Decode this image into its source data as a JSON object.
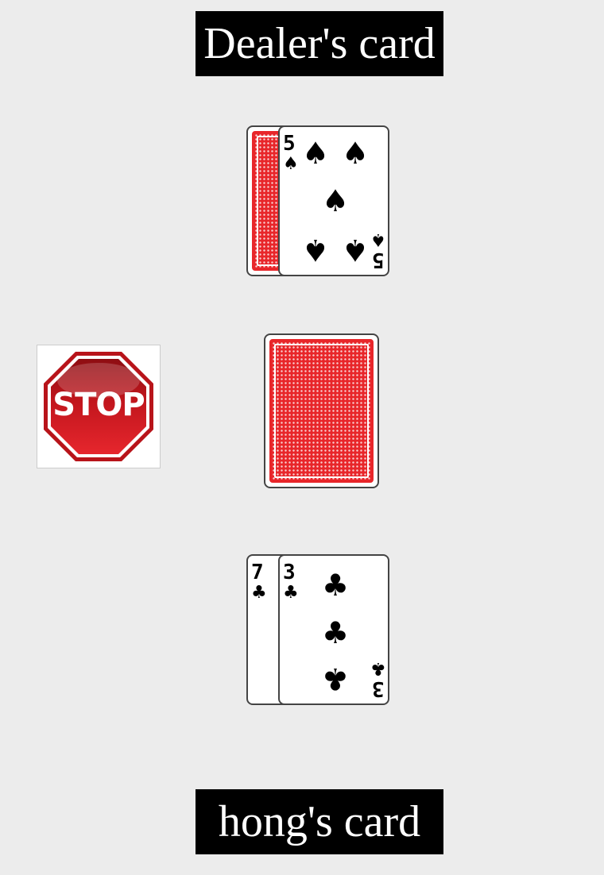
{
  "dealer": {
    "label": "Dealer's card",
    "cards": [
      {
        "face": "down"
      },
      {
        "rank": "5",
        "suit": "spades",
        "suit_glyph": "♠"
      }
    ]
  },
  "deck": {
    "face": "down"
  },
  "stop_button": {
    "label": "STOP",
    "icon": "stop-sign-icon",
    "color": "#d42028"
  },
  "player": {
    "label": "hong's card",
    "cards": [
      {
        "rank": "7",
        "suit": "clubs",
        "suit_glyph": "♣"
      },
      {
        "rank": "3",
        "suit": "clubs",
        "suit_glyph": "♣"
      }
    ]
  },
  "colors": {
    "background": "#ececec",
    "card_back": "#e8262a",
    "label_bg": "#000000",
    "label_text": "#ffffff"
  }
}
